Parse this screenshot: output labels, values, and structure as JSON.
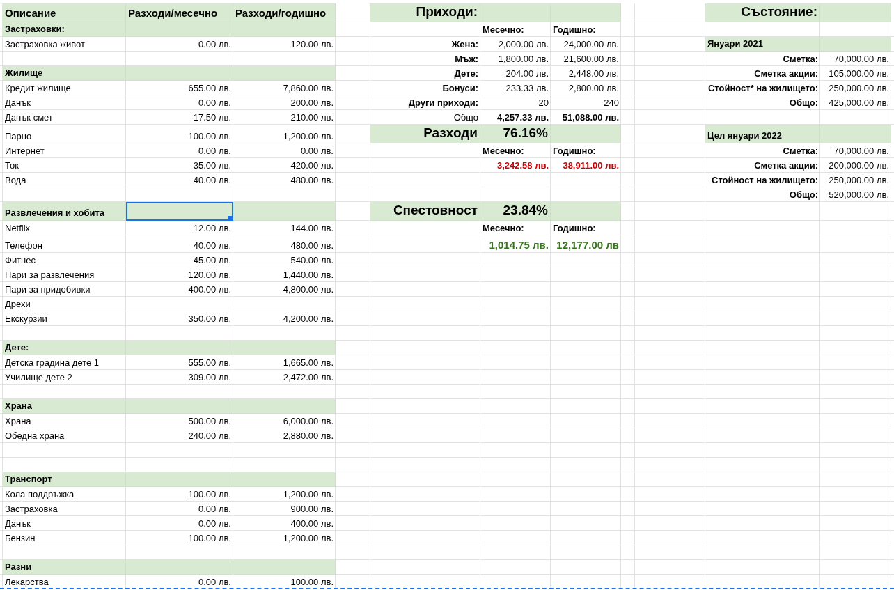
{
  "sheet": {
    "rows": [
      {
        "kind": "data",
        "cells": {
          "A": {
            "kind": "head",
            "text": "Описание",
            "shaded": true,
            "selected": false
          },
          "B": {
            "kind": "head",
            "text": "Разходи/месечно",
            "shaded": true,
            "selected": false
          },
          "C": {
            "kind": "head",
            "text": "Разходи/годишно",
            "shaded": true,
            "selected": false
          },
          "E": {
            "kind": "title",
            "text": "Приходи:",
            "shaded": true,
            "selected": false
          },
          "F": {
            "kind": "blank",
            "shaded": true,
            "selected": false
          },
          "G": {
            "kind": "blank",
            "shaded": true,
            "selected": false
          },
          "J": {
            "kind": "title",
            "text": "Състояние:",
            "shaded": true,
            "selected": false
          },
          "K": {
            "kind": "blank",
            "shaded": true,
            "selected": false
          }
        }
      },
      {
        "kind": "data",
        "cells": {
          "A": {
            "kind": "section",
            "text": "Застраховки:",
            "shaded": true,
            "selected": false
          },
          "B": {
            "kind": "blank",
            "shaded": true,
            "selected": false
          },
          "C": {
            "kind": "blank",
            "shaded": true,
            "selected": false
          },
          "F": {
            "kind": "colhead",
            "text": "Месечно:",
            "shaded": false,
            "selected": false
          },
          "G": {
            "kind": "colhead",
            "text": "Годишно:",
            "shaded": false,
            "selected": false
          }
        }
      },
      {
        "kind": "data",
        "cells": {
          "A": {
            "kind": "label",
            "text": "Застраховка живот",
            "shaded": false,
            "selected": false
          },
          "B": {
            "kind": "num",
            "text": "0.00 лв.",
            "shaded": false,
            "selected": false
          },
          "C": {
            "kind": "num",
            "text": "120.00 лв.",
            "shaded": false,
            "selected": false
          },
          "E": {
            "kind": "lab_r",
            "text": "Жена:",
            "shaded": false,
            "selected": false
          },
          "F": {
            "kind": "num",
            "text": "2,000.00 лв.",
            "shaded": false,
            "selected": false
          },
          "G": {
            "kind": "num",
            "text": "24,000.00 лв.",
            "shaded": false,
            "selected": false
          },
          "J": {
            "kind": "section",
            "text": "Януари 2021",
            "shaded": true,
            "selected": false
          },
          "K": {
            "kind": "blank",
            "shaded": true,
            "selected": false
          }
        }
      },
      {
        "kind": "data",
        "cells": {
          "E": {
            "kind": "lab_r",
            "text": "Мъж:",
            "shaded": false,
            "selected": false
          },
          "F": {
            "kind": "num",
            "text": "1,800.00 лв.",
            "shaded": false,
            "selected": false
          },
          "G": {
            "kind": "num",
            "text": "21,600.00 лв.",
            "shaded": false,
            "selected": false
          },
          "J": {
            "kind": "lab_r",
            "text": "Сметка:",
            "shaded": false,
            "selected": false
          },
          "K": {
            "kind": "num",
            "text": "70,000.00 лв.",
            "shaded": false,
            "selected": false
          }
        }
      },
      {
        "kind": "data",
        "cells": {
          "A": {
            "kind": "section",
            "text": "Жилище",
            "shaded": true,
            "selected": false
          },
          "B": {
            "kind": "blank",
            "shaded": true,
            "selected": false
          },
          "C": {
            "kind": "blank",
            "shaded": true,
            "selected": false
          },
          "E": {
            "kind": "lab_r",
            "text": "Дете:",
            "shaded": false,
            "selected": false
          },
          "F": {
            "kind": "num",
            "text": "204.00 лв.",
            "shaded": false,
            "selected": false
          },
          "G": {
            "kind": "num",
            "text": "2,448.00 лв.",
            "shaded": false,
            "selected": false
          },
          "J": {
            "kind": "lab_r",
            "text": "Сметка акции:",
            "shaded": false,
            "selected": false
          },
          "K": {
            "kind": "num",
            "text": "105,000.00 лв.",
            "shaded": false,
            "selected": false
          }
        }
      },
      {
        "kind": "data",
        "cells": {
          "A": {
            "kind": "label",
            "text": "Кредит жилище",
            "shaded": false,
            "selected": false
          },
          "B": {
            "kind": "num",
            "text": "655.00 лв.",
            "shaded": false,
            "selected": false
          },
          "C": {
            "kind": "num",
            "text": "7,860.00 лв.",
            "shaded": false,
            "selected": false
          },
          "E": {
            "kind": "lab_r",
            "text": "Бонуси:",
            "shaded": false,
            "selected": false
          },
          "F": {
            "kind": "num",
            "text": "233.33 лв.",
            "shaded": false,
            "selected": false
          },
          "G": {
            "kind": "num",
            "text": "2,800.00 лв.",
            "shaded": false,
            "selected": false
          },
          "J": {
            "kind": "lab_r",
            "text": "Стойност* на жилището:",
            "shaded": false,
            "selected": false
          },
          "K": {
            "kind": "num",
            "text": "250,000.00 лв.",
            "shaded": false,
            "selected": false
          }
        }
      },
      {
        "kind": "data",
        "cells": {
          "A": {
            "kind": "label",
            "text": "Данък",
            "shaded": false,
            "selected": false
          },
          "B": {
            "kind": "num",
            "text": "0.00 лв.",
            "shaded": false,
            "selected": false
          },
          "C": {
            "kind": "num",
            "text": "200.00 лв.",
            "shaded": false,
            "selected": false
          },
          "E": {
            "kind": "lab_r",
            "text": "Други приходи:",
            "shaded": false,
            "selected": false
          },
          "F": {
            "kind": "num",
            "text": "20",
            "shaded": false,
            "selected": false
          },
          "G": {
            "kind": "num",
            "text": "240",
            "shaded": false,
            "selected": false
          },
          "J": {
            "kind": "lab_r",
            "text": "Общо:",
            "shaded": false,
            "selected": false
          },
          "K": {
            "kind": "num",
            "text": "425,000.00 лв.",
            "shaded": false,
            "selected": false
          }
        }
      },
      {
        "kind": "data",
        "cells": {
          "A": {
            "kind": "label",
            "text": "Данък смет",
            "shaded": false,
            "selected": false
          },
          "B": {
            "kind": "num",
            "text": "17.50 лв.",
            "shaded": false,
            "selected": false
          },
          "C": {
            "kind": "num",
            "text": "210.00 лв.",
            "shaded": false,
            "selected": false
          },
          "E": {
            "kind": "plain_r",
            "text": "Общо",
            "shaded": false,
            "selected": false
          },
          "F": {
            "kind": "total",
            "text": "4,257.33 лв.",
            "shaded": false,
            "selected": false
          },
          "G": {
            "kind": "total",
            "text": "51,088.00 лв.",
            "shaded": false,
            "selected": false
          }
        }
      },
      {
        "kind": "data",
        "cells": {
          "A": {
            "kind": "label",
            "text": "Парно",
            "shaded": false,
            "selected": false
          },
          "B": {
            "kind": "num",
            "text": "100.00 лв.",
            "shaded": false,
            "selected": false
          },
          "C": {
            "kind": "num",
            "text": "1,200.00 лв.",
            "shaded": false,
            "selected": false
          },
          "E": {
            "kind": "title",
            "text": "Разходи",
            "shaded": true,
            "selected": false
          },
          "F": {
            "kind": "pct",
            "text": "76.16%",
            "shaded": true,
            "selected": false
          },
          "G": {
            "kind": "blank",
            "shaded": true,
            "selected": false
          },
          "J": {
            "kind": "section",
            "text": "Цел януари 2022",
            "shaded": true,
            "selected": false
          },
          "K": {
            "kind": "blank",
            "shaded": true,
            "selected": false
          }
        }
      },
      {
        "kind": "data",
        "cells": {
          "A": {
            "kind": "label",
            "text": "Интернет",
            "shaded": false,
            "selected": false
          },
          "B": {
            "kind": "num",
            "text": "0.00 лв.",
            "shaded": false,
            "selected": false
          },
          "C": {
            "kind": "num",
            "text": "0.00 лв.",
            "shaded": false,
            "selected": false
          },
          "F": {
            "kind": "colhead",
            "text": "Месечно:",
            "shaded": false,
            "selected": false
          },
          "G": {
            "kind": "colhead",
            "text": "Годишно:",
            "shaded": false,
            "selected": false
          },
          "J": {
            "kind": "lab_r",
            "text": "Сметка:",
            "shaded": false,
            "selected": false
          },
          "K": {
            "kind": "num",
            "text": "70,000.00 лв.",
            "shaded": false,
            "selected": false
          }
        }
      },
      {
        "kind": "data",
        "cells": {
          "A": {
            "kind": "label",
            "text": "Ток",
            "shaded": false,
            "selected": false
          },
          "B": {
            "kind": "num",
            "text": "35.00 лв.",
            "shaded": false,
            "selected": false
          },
          "C": {
            "kind": "num",
            "text": "420.00 лв.",
            "shaded": false,
            "selected": false
          },
          "F": {
            "kind": "expense",
            "text": "3,242.58 лв.",
            "shaded": false,
            "selected": false
          },
          "G": {
            "kind": "expense",
            "text": "38,911.00 лв.",
            "shaded": false,
            "selected": false
          },
          "J": {
            "kind": "lab_r",
            "text": "Сметка акции:",
            "shaded": false,
            "selected": false
          },
          "K": {
            "kind": "num",
            "text": "200,000.00 лв.",
            "shaded": false,
            "selected": false
          }
        }
      },
      {
        "kind": "data",
        "cells": {
          "A": {
            "kind": "label",
            "text": "Вода",
            "shaded": false,
            "selected": false
          },
          "B": {
            "kind": "num",
            "text": "40.00 лв.",
            "shaded": false,
            "selected": false
          },
          "C": {
            "kind": "num",
            "text": "480.00 лв.",
            "shaded": false,
            "selected": false
          },
          "J": {
            "kind": "lab_r",
            "text": "Стойност на жилището:",
            "shaded": false,
            "selected": false
          },
          "K": {
            "kind": "num",
            "text": "250,000.00 лв.",
            "shaded": false,
            "selected": false
          }
        }
      },
      {
        "kind": "data",
        "cells": {
          "J": {
            "kind": "lab_r",
            "text": "Общо:",
            "shaded": false,
            "selected": false
          },
          "K": {
            "kind": "num",
            "text": "520,000.00 лв.",
            "shaded": false,
            "selected": false
          }
        }
      },
      {
        "kind": "data",
        "cells": {
          "A": {
            "kind": "section",
            "text": "Развлечения и хобита",
            "shaded": true,
            "selected": false
          },
          "B": {
            "kind": "blank",
            "shaded": true,
            "selected": true
          },
          "C": {
            "kind": "blank",
            "shaded": true,
            "selected": false
          },
          "E": {
            "kind": "title",
            "text": "Спестовност",
            "shaded": true,
            "selected": false
          },
          "F": {
            "kind": "pct",
            "text": "23.84%",
            "shaded": true,
            "selected": false
          },
          "G": {
            "kind": "blank",
            "shaded": true,
            "selected": false
          }
        }
      },
      {
        "kind": "data",
        "cells": {
          "A": {
            "kind": "label",
            "text": "Netflix",
            "shaded": false,
            "selected": false
          },
          "B": {
            "kind": "num",
            "text": "12.00 лв.",
            "shaded": false,
            "selected": false
          },
          "C": {
            "kind": "num",
            "text": "144.00 лв.",
            "shaded": false,
            "selected": false
          },
          "F": {
            "kind": "colhead",
            "text": "Месечно:",
            "shaded": false,
            "selected": false
          },
          "G": {
            "kind": "colhead",
            "text": "Годишно:",
            "shaded": false,
            "selected": false
          }
        }
      },
      {
        "kind": "data",
        "cells": {
          "A": {
            "kind": "label",
            "text": "Телефон",
            "shaded": false,
            "selected": false
          },
          "B": {
            "kind": "num",
            "text": "40.00 лв.",
            "shaded": false,
            "selected": false
          },
          "C": {
            "kind": "num",
            "text": "480.00 лв.",
            "shaded": false,
            "selected": false
          },
          "F": {
            "kind": "saving",
            "text": "1,014.75 лв.",
            "shaded": false,
            "selected": false
          },
          "G": {
            "kind": "saving",
            "text": "12,177.00 лв",
            "shaded": false,
            "selected": false
          }
        }
      },
      {
        "kind": "data",
        "cells": {
          "A": {
            "kind": "label",
            "text": "Фитнес",
            "shaded": false,
            "selected": false
          },
          "B": {
            "kind": "num",
            "text": "45.00 лв.",
            "shaded": false,
            "selected": false
          },
          "C": {
            "kind": "num",
            "text": "540.00 лв.",
            "shaded": false,
            "selected": false
          }
        }
      },
      {
        "kind": "data",
        "cells": {
          "A": {
            "kind": "label",
            "text": "Пари за развлечения",
            "shaded": false,
            "selected": false
          },
          "B": {
            "kind": "num",
            "text": "120.00 лв.",
            "shaded": false,
            "selected": false
          },
          "C": {
            "kind": "num",
            "text": "1,440.00 лв.",
            "shaded": false,
            "selected": false
          }
        }
      },
      {
        "kind": "data",
        "cells": {
          "A": {
            "kind": "label",
            "text": "Пари за придобивки",
            "shaded": false,
            "selected": false
          },
          "B": {
            "kind": "num",
            "text": "400.00 лв.",
            "shaded": false,
            "selected": false
          },
          "C": {
            "kind": "num",
            "text": "4,800.00 лв.",
            "shaded": false,
            "selected": false
          }
        }
      },
      {
        "kind": "data",
        "cells": {
          "A": {
            "kind": "label",
            "text": "Дрехи",
            "shaded": false,
            "selected": false
          }
        }
      },
      {
        "kind": "data",
        "cells": {
          "A": {
            "kind": "label",
            "text": "Екскурзии",
            "shaded": false,
            "selected": false
          },
          "B": {
            "kind": "num",
            "text": "350.00 лв.",
            "shaded": false,
            "selected": false
          },
          "C": {
            "kind": "num",
            "text": "4,200.00 лв.",
            "shaded": false,
            "selected": false
          }
        }
      },
      {
        "kind": "blank"
      },
      {
        "kind": "data",
        "cells": {
          "A": {
            "kind": "section",
            "text": "Дете:",
            "shaded": true,
            "selected": false
          },
          "B": {
            "kind": "blank",
            "shaded": true,
            "selected": false
          },
          "C": {
            "kind": "blank",
            "shaded": true,
            "selected": false
          }
        }
      },
      {
        "kind": "data",
        "cells": {
          "A": {
            "kind": "label",
            "text": "Детска градина дете 1",
            "shaded": false,
            "selected": false
          },
          "B": {
            "kind": "num",
            "text": "555.00 лв.",
            "shaded": false,
            "selected": false
          },
          "C": {
            "kind": "num",
            "text": "1,665.00 лв.",
            "shaded": false,
            "selected": false
          }
        }
      },
      {
        "kind": "data",
        "cells": {
          "A": {
            "kind": "label",
            "text": "Училище дете 2",
            "shaded": false,
            "selected": false
          },
          "B": {
            "kind": "num",
            "text": "309.00 лв.",
            "shaded": false,
            "selected": false
          },
          "C": {
            "kind": "num",
            "text": "2,472.00 лв.",
            "shaded": false,
            "selected": false
          }
        }
      },
      {
        "kind": "blank"
      },
      {
        "kind": "data",
        "cells": {
          "A": {
            "kind": "section",
            "text": "Храна",
            "shaded": true,
            "selected": false
          },
          "B": {
            "kind": "blank",
            "shaded": true,
            "selected": false
          },
          "C": {
            "kind": "blank",
            "shaded": true,
            "selected": false
          }
        }
      },
      {
        "kind": "data",
        "cells": {
          "A": {
            "kind": "label",
            "text": "Храна",
            "shaded": false,
            "selected": false
          },
          "B": {
            "kind": "num",
            "text": "500.00 лв.",
            "shaded": false,
            "selected": false
          },
          "C": {
            "kind": "num",
            "text": "6,000.00 лв.",
            "shaded": false,
            "selected": false
          }
        }
      },
      {
        "kind": "data",
        "cells": {
          "A": {
            "kind": "label",
            "text": "Обедна храна",
            "shaded": false,
            "selected": false
          },
          "B": {
            "kind": "num",
            "text": "240.00 лв.",
            "shaded": false,
            "selected": false
          },
          "C": {
            "kind": "num",
            "text": "2,880.00 лв.",
            "shaded": false,
            "selected": false
          }
        }
      },
      {
        "kind": "blank"
      },
      {
        "kind": "blank"
      },
      {
        "kind": "data",
        "cells": {
          "A": {
            "kind": "section",
            "text": "Транспорт",
            "shaded": true,
            "selected": false
          },
          "B": {
            "kind": "blank",
            "shaded": true,
            "selected": false
          },
          "C": {
            "kind": "blank",
            "shaded": true,
            "selected": false
          }
        }
      },
      {
        "kind": "data",
        "cells": {
          "A": {
            "kind": "label",
            "text": "Кола поддръжка",
            "shaded": false,
            "selected": false
          },
          "B": {
            "kind": "num",
            "text": "100.00 лв.",
            "shaded": false,
            "selected": false
          },
          "C": {
            "kind": "num",
            "text": "1,200.00 лв.",
            "shaded": false,
            "selected": false
          }
        }
      },
      {
        "kind": "data",
        "cells": {
          "A": {
            "kind": "label",
            "text": "Застраховка",
            "shaded": false,
            "selected": false
          },
          "B": {
            "kind": "num",
            "text": "0.00 лв.",
            "shaded": false,
            "selected": false
          },
          "C": {
            "kind": "num",
            "text": "900.00 лв.",
            "shaded": false,
            "selected": false
          }
        }
      },
      {
        "kind": "data",
        "cells": {
          "A": {
            "kind": "label",
            "text": "Данък",
            "shaded": false,
            "selected": false
          },
          "B": {
            "kind": "num",
            "text": "0.00 лв.",
            "shaded": false,
            "selected": false
          },
          "C": {
            "kind": "num",
            "text": "400.00 лв.",
            "shaded": false,
            "selected": false
          }
        }
      },
      {
        "kind": "data",
        "cells": {
          "A": {
            "kind": "label",
            "text": "Бензин",
            "shaded": false,
            "selected": false
          },
          "B": {
            "kind": "num",
            "text": "100.00 лв.",
            "shaded": false,
            "selected": false
          },
          "C": {
            "kind": "num",
            "text": "1,200.00 лв.",
            "shaded": false,
            "selected": false
          }
        }
      },
      {
        "kind": "blank"
      },
      {
        "kind": "data",
        "cells": {
          "A": {
            "kind": "section",
            "text": "Разни",
            "shaded": true,
            "selected": false
          },
          "B": {
            "kind": "blank",
            "shaded": true,
            "selected": false
          },
          "C": {
            "kind": "blank",
            "shaded": true,
            "selected": false
          }
        }
      },
      {
        "kind": "data",
        "cells": {
          "A": {
            "kind": "label",
            "text": "Лекарства",
            "shaded": false,
            "selected": false
          },
          "B": {
            "kind": "num",
            "text": "0.00 лв.",
            "shaded": false,
            "selected": false
          },
          "C": {
            "kind": "num",
            "text": "100.00 лв.",
            "shaded": false,
            "selected": false
          }
        }
      }
    ]
  }
}
